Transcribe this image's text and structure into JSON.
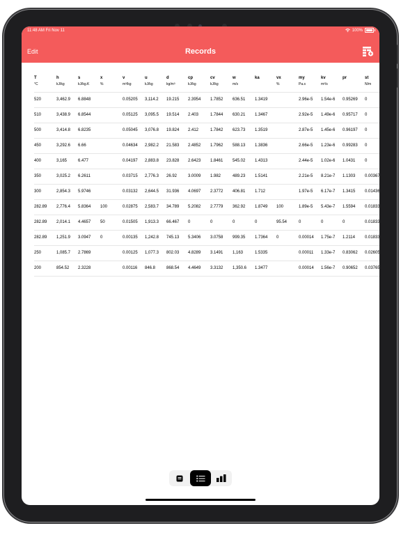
{
  "status_bar": {
    "time": "11:48 AM  Fri Nov 11",
    "battery": "100%"
  },
  "nav": {
    "edit": "Edit",
    "title": "Records",
    "add_icon": "table-add-icon"
  },
  "table": {
    "columns": [
      {
        "name": "T",
        "unit": "°C"
      },
      {
        "name": "h",
        "unit": "kJ/kg"
      },
      {
        "name": "s",
        "unit": "kJ/kg.K"
      },
      {
        "name": "x",
        "unit": "%"
      },
      {
        "name": "v",
        "unit": "m³/kg"
      },
      {
        "name": "u",
        "unit": "kJ/kg"
      },
      {
        "name": "d",
        "unit": "kg/m³"
      },
      {
        "name": "cp",
        "unit": "kJ/kg"
      },
      {
        "name": "cv",
        "unit": "kJ/kg"
      },
      {
        "name": "w",
        "unit": "m/s"
      },
      {
        "name": "ka",
        "unit": ""
      },
      {
        "name": "vx",
        "unit": "%"
      },
      {
        "name": "my",
        "unit": "Pa.s"
      },
      {
        "name": "kv",
        "unit": "m²/s"
      },
      {
        "name": "pr",
        "unit": ""
      },
      {
        "name": "st",
        "unit": "N/m"
      }
    ],
    "rows": [
      [
        "520",
        "3,462.9",
        "6.8848",
        "",
        "0.05205",
        "3,114.2",
        "19.215",
        "2.3954",
        "1.7852",
        "636.51",
        "1.3419",
        "",
        "2.96e-5",
        "1.54e-6",
        "0.95269",
        "0"
      ],
      [
        "510",
        "3,438.9",
        "6.8544",
        "",
        "0.05125",
        "3,095.5",
        "19.514",
        "2.403",
        "1.7844",
        "630.21",
        "1.3467",
        "",
        "2.92e-5",
        "1.49e-6",
        "0.95717",
        "0"
      ],
      [
        "500",
        "3,414.8",
        "6.8235",
        "",
        "0.05045",
        "3,076.8",
        "19.824",
        "2.412",
        "1.7842",
        "623.73",
        "1.3519",
        "",
        "2.87e-5",
        "1.45e-6",
        "0.96197",
        "0"
      ],
      [
        "450",
        "3,292.6",
        "6.66",
        "",
        "0.04634",
        "2,982.2",
        "21.583",
        "2.4852",
        "1.7962",
        "588.13",
        "1.3836",
        "",
        "2.66e-5",
        "1.23e-6",
        "0.99283",
        "0"
      ],
      [
        "400",
        "3,165",
        "6.477",
        "",
        "0.04197",
        "2,883.8",
        "23.828",
        "2.6423",
        "1.8461",
        "545.02",
        "1.4313",
        "",
        "2.44e-5",
        "1.02e-6",
        "1.0431",
        "0"
      ],
      [
        "350",
        "3,025.2",
        "6.2611",
        "",
        "0.03715",
        "2,776.3",
        "26.92",
        "3.0009",
        "1.982",
        "489.23",
        "1.5141",
        "",
        "2.21e-5",
        "8.21e-7",
        "1.1303",
        "0.00367"
      ],
      [
        "300",
        "2,854.3",
        "5.9746",
        "",
        "0.03132",
        "2,644.5",
        "31.936",
        "4.0697",
        "2.3772",
        "406.81",
        "1.712",
        "",
        "1.97e-5",
        "6.17e-7",
        "1.3415",
        "0.01436"
      ],
      [
        "282.89",
        "2,776.4",
        "5.8364",
        "100",
        "0.02875",
        "2,583.7",
        "34.789",
        "5.2082",
        "2.7779",
        "362.92",
        "1.8749",
        "100",
        "1.89e-5",
        "5.43e-7",
        "1.5594",
        "0.01833"
      ],
      [
        "282.89",
        "2,014.1",
        "4.4657",
        "50",
        "0.01505",
        "1,913.3",
        "66.467",
        "0",
        "0",
        "0",
        "0",
        "95.54",
        "0",
        "0",
        "0",
        "0.01833"
      ],
      [
        "282.89",
        "1,251.9",
        "3.0947",
        "0",
        "0.00135",
        "1,242.8",
        "745.13",
        "5.3406",
        "3.0758",
        "999.35",
        "1.7364",
        "0",
        "0.00014",
        "1.75e-7",
        "1.2114",
        "0.01833"
      ],
      [
        "250",
        "1,085.7",
        "2.7869",
        "",
        "0.00125",
        "1,077.3",
        "802.03",
        "4.8289",
        "3.1491",
        "1,163",
        "1.5335",
        "",
        "0.00011",
        "1.33e-7",
        "0.83062",
        "0.02605"
      ],
      [
        "200",
        "854.52",
        "2.3228",
        "",
        "0.00116",
        "846.8",
        "868.54",
        "4.4649",
        "3.3132",
        "1,350.6",
        "1.3477",
        "",
        "0.00014",
        "1.56e-7",
        "0.90652",
        "0.03765"
      ]
    ]
  },
  "view_switcher": {
    "options": [
      {
        "icon": "single-record-icon",
        "active": false
      },
      {
        "icon": "list-icon",
        "active": true
      },
      {
        "icon": "bar-chart-icon",
        "active": false
      }
    ]
  }
}
